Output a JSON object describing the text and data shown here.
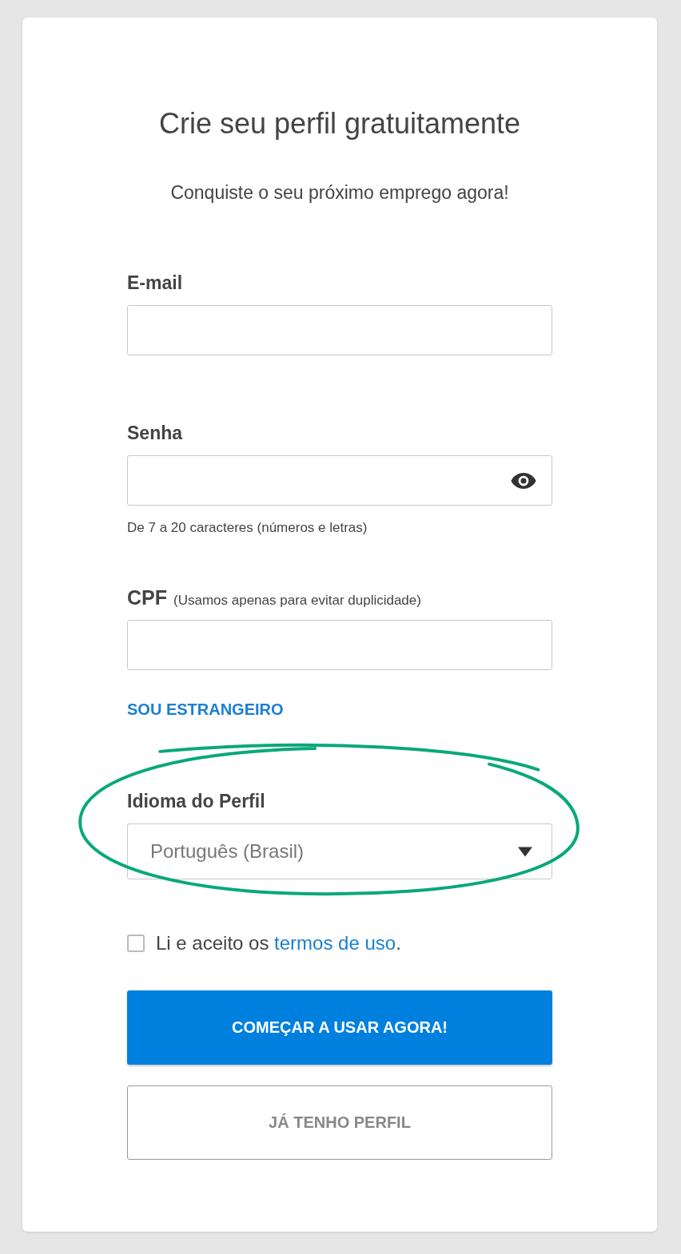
{
  "title": "Crie seu perfil gratuitamente",
  "subtitle": "Conquiste o seu próximo emprego agora!",
  "fields": [
    {
      "kind": "text",
      "label": "E-mail"
    },
    {
      "kind": "password",
      "label": "Senha",
      "hint": "De 7 a 20 caracteres (números e letras)"
    },
    {
      "kind": "text",
      "label": "CPF",
      "note": "(Usamos apenas para evitar duplicidade)"
    }
  ],
  "foreigner_link": "SOU ESTRANGEIRO",
  "language": {
    "label": "Idioma do Perfil",
    "value": "Português (Brasil)"
  },
  "terms": {
    "checked": false,
    "before": "Li e aceito os ",
    "link": "termos de uso",
    "after": "."
  },
  "primary_button": "COMEÇAR A USAR AGORA!",
  "secondary_button": "JÁ TENHO PERFIL"
}
